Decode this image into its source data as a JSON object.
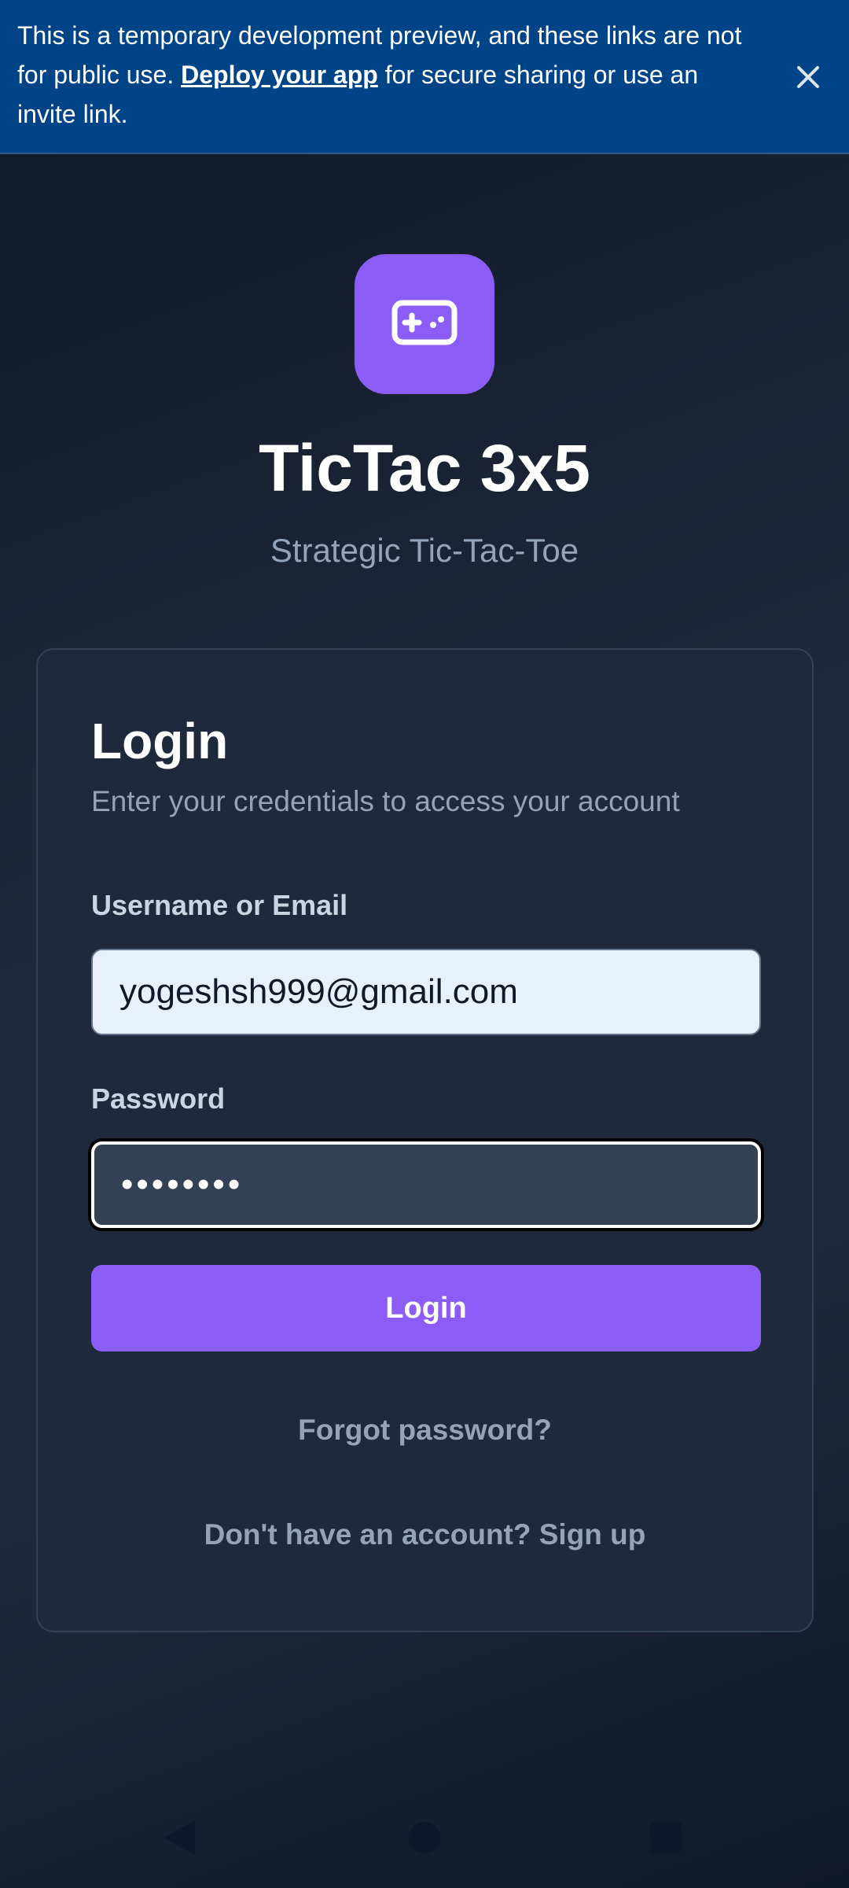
{
  "banner": {
    "text_before": "This is a temporary development preview, and these links are not for public use. ",
    "link_text": "Deploy your app",
    "text_after": " for secure sharing or use an invite link.",
    "close_icon": "close-icon"
  },
  "app": {
    "logo_icon": "gamepad-icon",
    "title": "TicTac 3x5",
    "subtitle": "Strategic Tic-Tac-Toe"
  },
  "login_card": {
    "title": "Login",
    "description": "Enter your credentials to access your account",
    "username_label": "Username or Email",
    "username_value": "yogeshsh999@gmail.com",
    "password_label": "Password",
    "password_value": "••••••••",
    "login_button": "Login",
    "forgot_password": "Forgot password?",
    "signup_prompt": "Don't have an account? Sign up"
  },
  "system_nav": {
    "back_icon": "back-triangle-icon",
    "home_icon": "home-circle-icon",
    "recents_icon": "recents-square-icon"
  },
  "colors": {
    "banner_bg": "#004488",
    "accent": "#8b5cf6",
    "card_bg": "#1e293b",
    "muted_text": "#94a3b8"
  }
}
